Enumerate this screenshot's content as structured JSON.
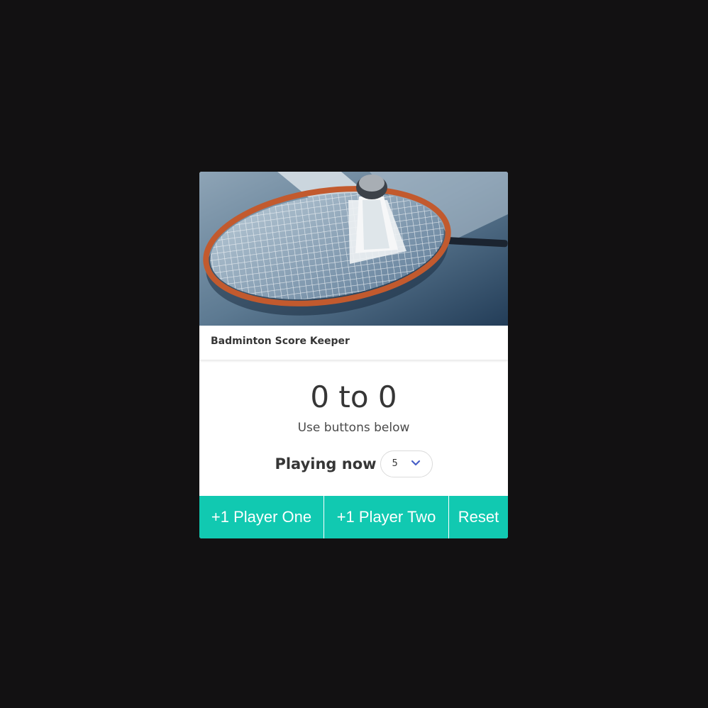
{
  "card": {
    "title": "Badminton Score Keeper",
    "image": "badminton-racket-and-shuttlecock-photo"
  },
  "score": {
    "player_one": 0,
    "player_two": 0,
    "display": "0 to 0",
    "hint": "Use buttons below"
  },
  "playing": {
    "label": "Playing now",
    "selected": "5"
  },
  "buttons": {
    "player_one": "+1 Player One",
    "player_two": "+1 Player Two",
    "reset": "Reset"
  },
  "colors": {
    "background": "#121112",
    "button": "#11c9b1",
    "chevron": "#485fc7"
  }
}
